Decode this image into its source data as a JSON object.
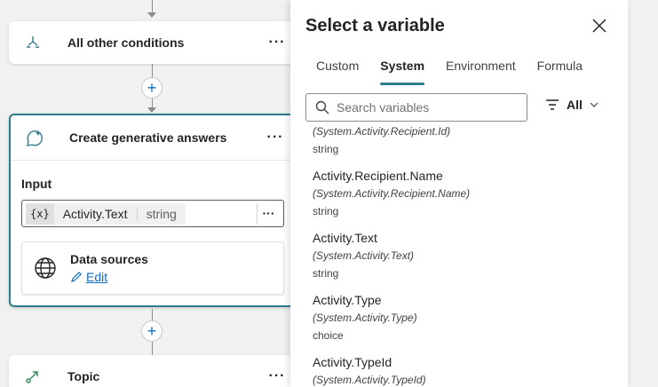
{
  "canvas": {
    "nodes": {
      "other_conditions": {
        "title": "All other conditions",
        "more": "···"
      },
      "generative": {
        "title": "Create generative answers",
        "more": "···",
        "input_label": "Input",
        "input_var_icon": "{x}",
        "input_var_name": "Activity.Text",
        "input_var_type": "string",
        "input_more": "···",
        "data_sources_title": "Data sources",
        "data_sources_edit": "Edit"
      },
      "topic": {
        "title": "Topic",
        "more": "···"
      }
    },
    "add_symbol": "+"
  },
  "panel": {
    "title": "Select a variable",
    "tabs": [
      {
        "label": "Custom"
      },
      {
        "label": "System"
      },
      {
        "label": "Environment"
      },
      {
        "label": "Formula"
      }
    ],
    "active_tab": "System",
    "search_placeholder": "Search variables",
    "filter_label": "All",
    "items": [
      {
        "name": "",
        "path": "(System.Activity.Recipient.Id)",
        "type": "string"
      },
      {
        "name": "Activity.Recipient.Name",
        "path": "(System.Activity.Recipient.Name)",
        "type": "string"
      },
      {
        "name": "Activity.Text",
        "path": "(System.Activity.Text)",
        "type": "string"
      },
      {
        "name": "Activity.Type",
        "path": "(System.Activity.Type)",
        "type": "choice"
      },
      {
        "name": "Activity.TypeId",
        "path": "(System.Activity.TypeId)",
        "type": ""
      }
    ]
  },
  "colors": {
    "accent": "#2e7d8c",
    "link": "#0f6cbd"
  }
}
